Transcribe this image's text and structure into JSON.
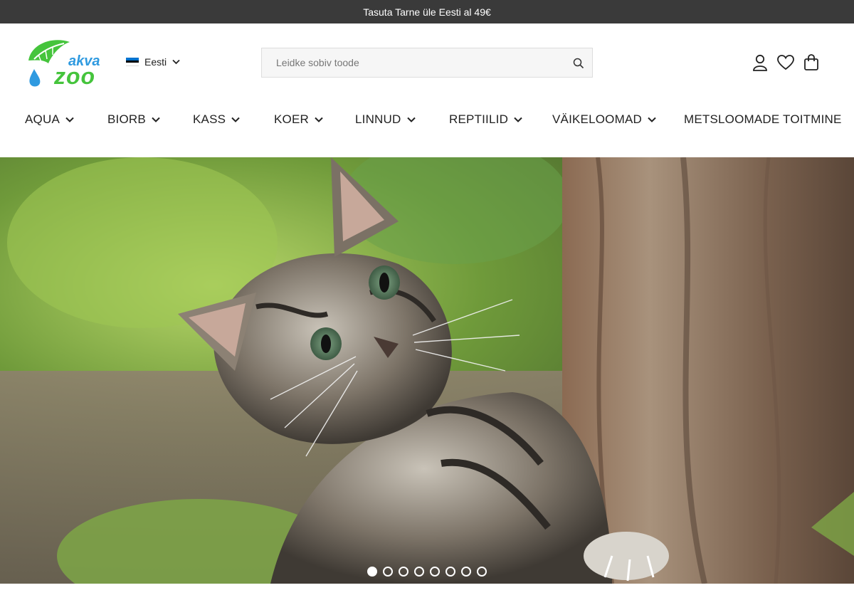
{
  "announcement": "Tasuta Tarne üle Eesti al 49€",
  "logo": {
    "top_text": "akva",
    "bottom_text": "zoo",
    "leaf_color": "#45c43c",
    "drop_color": "#2f9ae0"
  },
  "language": {
    "label": "Eesti",
    "icon": "estonia-flag-icon"
  },
  "search": {
    "placeholder": "Leidke sobiv toode",
    "icon": "search-icon"
  },
  "header_icons": [
    "user-icon",
    "heart-icon",
    "shopping-bag-icon"
  ],
  "nav": [
    {
      "label": "AQUA",
      "has_dropdown": true
    },
    {
      "label": "BIORB",
      "has_dropdown": true
    },
    {
      "label": "KASS",
      "has_dropdown": true
    },
    {
      "label": "KOER",
      "has_dropdown": true
    },
    {
      "label": "LINNUD",
      "has_dropdown": true
    },
    {
      "label": "REPTIILID",
      "has_dropdown": true
    },
    {
      "label": "VÄIKELOOMAD",
      "has_dropdown": true
    },
    {
      "label": "METSLOOMADE TOITMINE",
      "has_dropdown": false
    }
  ],
  "hero": {
    "subject": "kitten-climbing-tree",
    "slides_total": 8,
    "active_slide": 1
  },
  "colors": {
    "topbar_bg": "#3a3a3a",
    "brand_green": "#45c43c",
    "brand_blue": "#2f9ae0"
  }
}
